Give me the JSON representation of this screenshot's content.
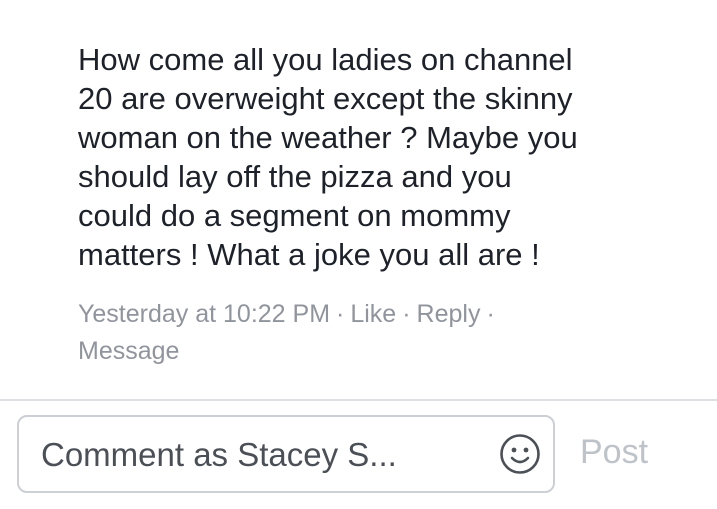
{
  "comment": {
    "text_lines": [
      "How come all you ladies on channel",
      "20 are overweight except the skinny",
      "woman on the weather ?  Maybe you",
      "should lay off the pizza and you",
      "could do a segment on mommy",
      "matters !  What a joke you all are !"
    ],
    "timestamp": "Yesterday at 10:22 PM",
    "like_label": "Like",
    "reply_label": "Reply",
    "message_label": "Message",
    "separator": "·"
  },
  "composer": {
    "placeholder": "Comment as Stacey S...",
    "emoji_icon": "smiley-face-icon",
    "post_label": "Post"
  },
  "colors": {
    "text": "#1d2129",
    "meta": "#90949c",
    "input_border": "#ccd0d5",
    "placeholder": "#4b4f56",
    "post_disabled": "#bec3c9"
  }
}
